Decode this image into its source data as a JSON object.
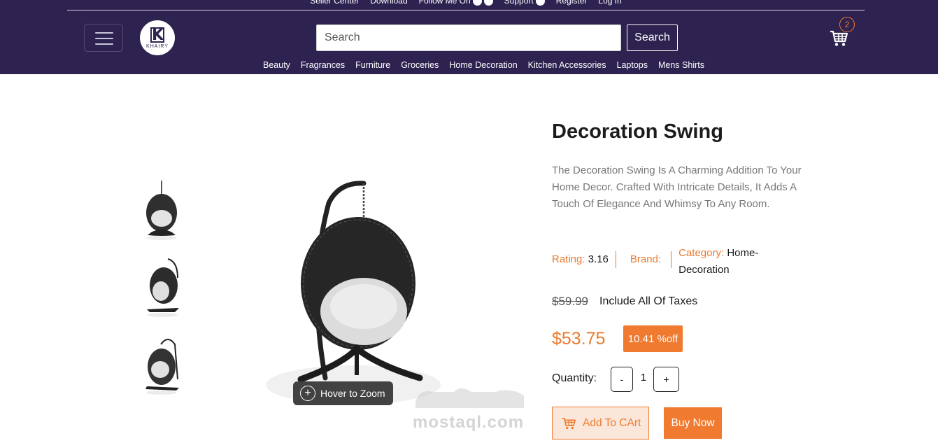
{
  "header": {
    "top_links": [
      "Seller Center",
      "Download",
      "Follow Me On",
      "Support",
      "Register",
      "Log In"
    ],
    "logo_text": "KHAIRY",
    "search": {
      "placeholder": "Search",
      "button_label": "Search"
    },
    "cart_count": "2",
    "categories": [
      "Beauty",
      "Fragrances",
      "Furniture",
      "Groceries",
      "Home Decoration",
      "Kitchen Accessories",
      "Laptops",
      "Mens Shirts"
    ]
  },
  "gallery": {
    "zoom_hint": "Hover to Zoom"
  },
  "product": {
    "title": "Decoration Swing",
    "description": "The Decoration Swing Is A Charming Addition To Your Home Decor. Crafted With Intricate Details, It Adds A Touch Of Elegance And Whimsy To Any Room.",
    "rating_label": "Rating:",
    "rating_value": "3.16",
    "brand_label": "Brand:",
    "category_label": "Category:",
    "category_value": "Home-Decoration",
    "old_price": "$59.99",
    "tax_note": "Include All Of Taxes",
    "price": "$53.75",
    "discount": "10.41 %off",
    "quantity_label": "Quantity:",
    "quantity_value": "1",
    "minus_label": "-",
    "plus_label": "+",
    "add_to_cart_label": "Add To CArt",
    "buy_now_label": "Buy Now"
  },
  "watermark": {
    "text": "mostaql.com"
  },
  "colors": {
    "header_bg": "#2e2250",
    "accent": "#ef7a30"
  }
}
